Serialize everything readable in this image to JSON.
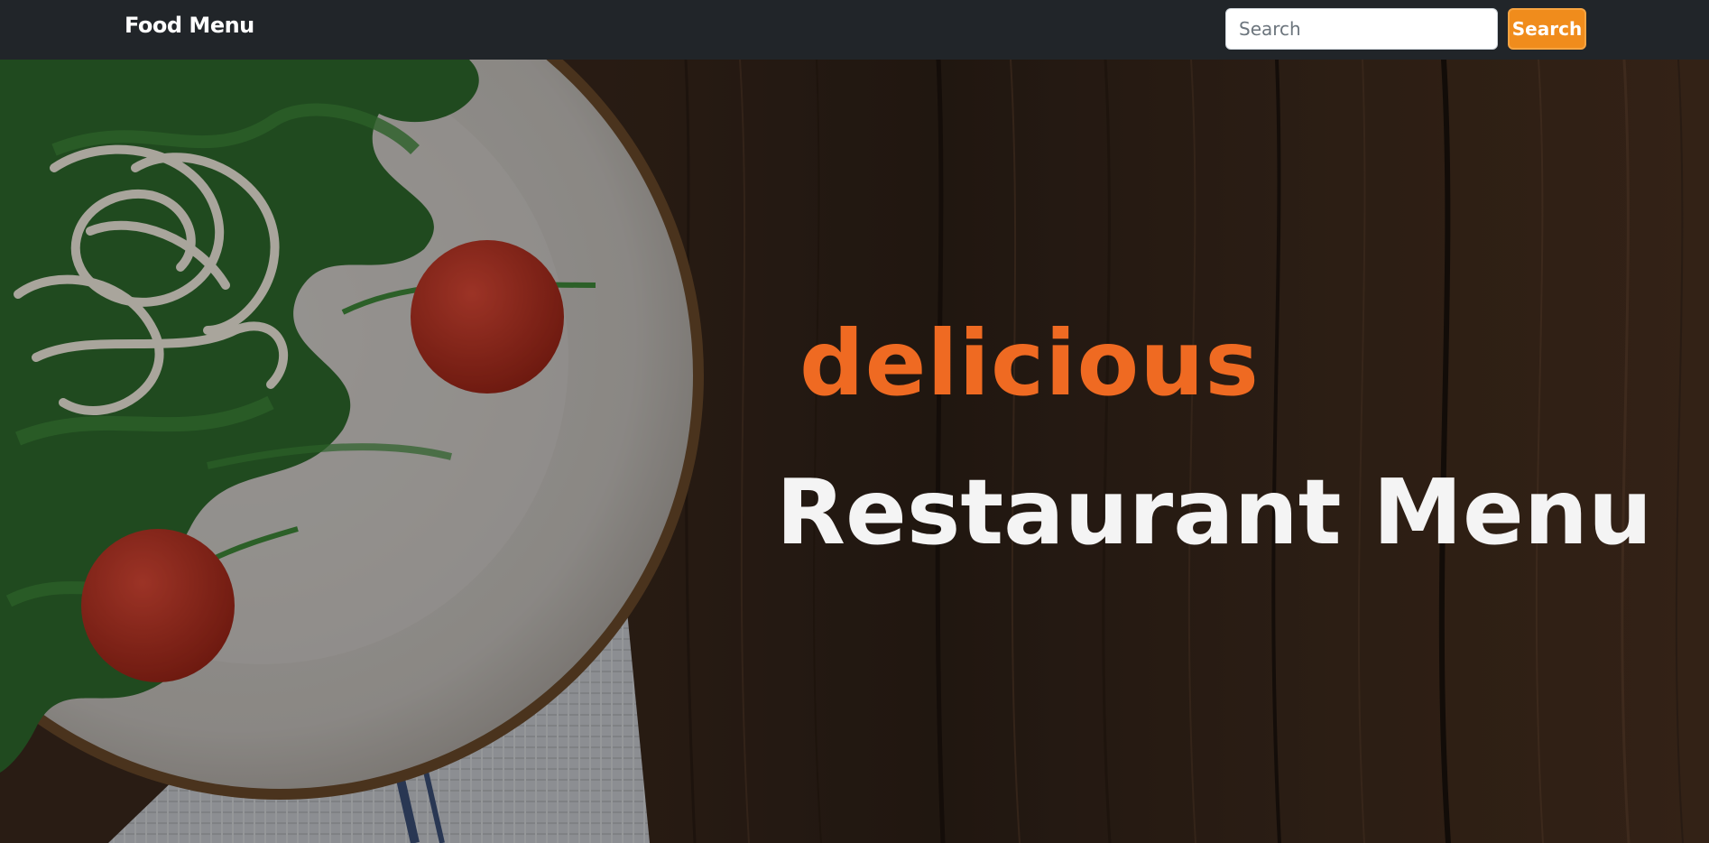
{
  "navbar": {
    "brand": "Food Menu",
    "search": {
      "placeholder": "Search",
      "value": "",
      "button_label": "Search"
    }
  },
  "hero": {
    "tagline": "delicious",
    "title": "Restaurant Menu"
  },
  "colors": {
    "navbar_bg": "#212529",
    "search_button": "#f08c1c",
    "tagline": "#ef6a22",
    "title": "#f4f4f4",
    "wood": "#3a2a1f"
  },
  "icons": {
    "hero_image": "salad-plate-on-wood"
  }
}
